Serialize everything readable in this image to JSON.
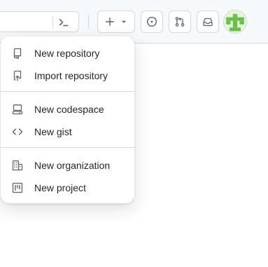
{
  "header": {
    "search": {
      "icon": "command-palette-icon"
    },
    "create_button": {
      "icon": "plus-icon",
      "caret": "triangle-down-icon"
    },
    "issues_button": {
      "icon": "issue-opened-icon"
    },
    "pulls_button": {
      "icon": "git-pull-request-icon"
    },
    "inbox_button": {
      "icon": "inbox-icon"
    },
    "avatar": {
      "colors": {
        "primary": "#6abf4b",
        "background": "#e8f5dc"
      }
    }
  },
  "create_menu": {
    "groups": [
      [
        {
          "label": "New repository",
          "icon": "repo-icon"
        },
        {
          "label": "Import repository",
          "icon": "repo-push-icon"
        }
      ],
      [
        {
          "label": "New codespace",
          "icon": "codespaces-icon"
        },
        {
          "label": "New gist",
          "icon": "code-icon"
        }
      ],
      [
        {
          "label": "New organization",
          "icon": "organization-icon"
        },
        {
          "label": "New project",
          "icon": "project-icon"
        }
      ]
    ]
  },
  "colors": {
    "icon": "#59636e",
    "text": "#1f2328",
    "border": "#d0d7de",
    "header_bg": "#f6f8fa"
  }
}
